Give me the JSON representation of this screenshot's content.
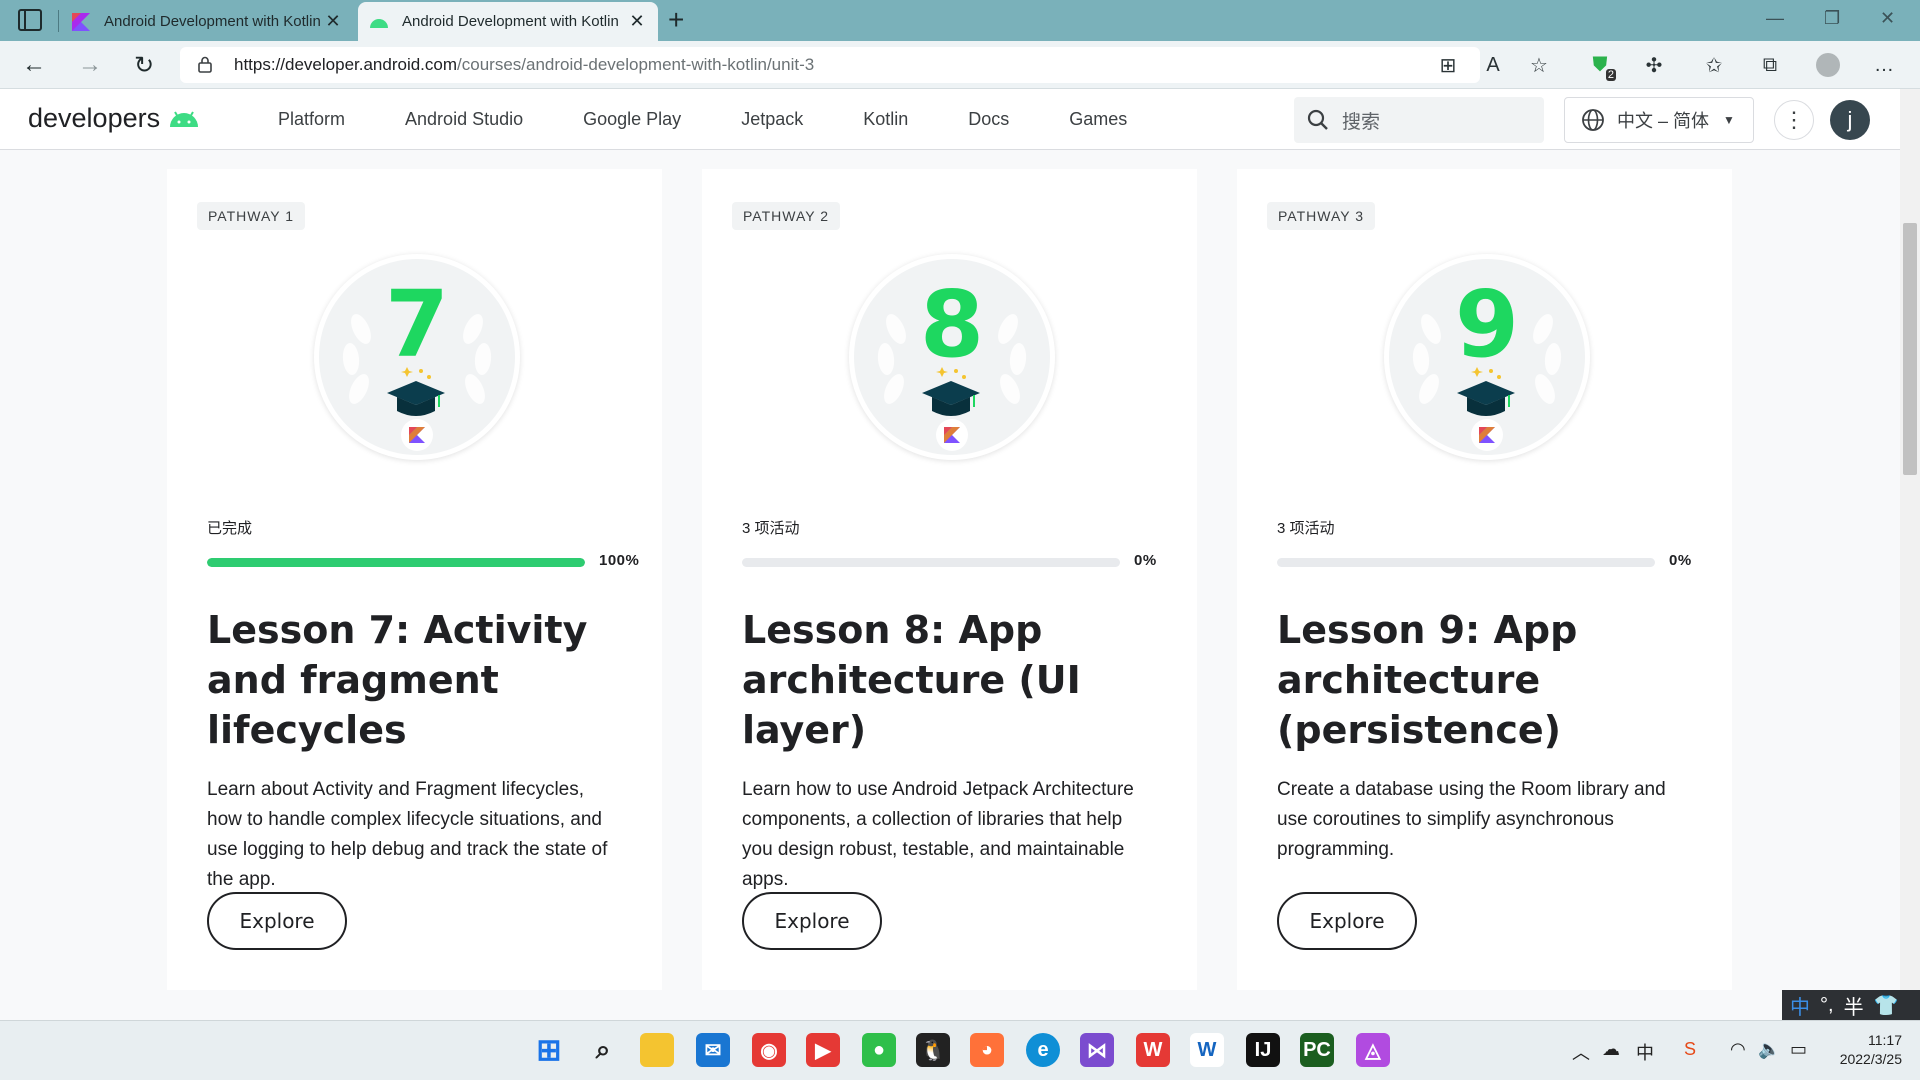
{
  "browser": {
    "tabs": [
      {
        "title": "Android Development with Kotlin"
      },
      {
        "title": "Android Development with Kotlin"
      }
    ],
    "url_host": "https://developer.android.com",
    "url_path": "/courses/android-development-with-kotlin/unit-3",
    "profile_badge": "2"
  },
  "site": {
    "logo_text": "developers",
    "nav": [
      "Platform",
      "Android Studio",
      "Google Play",
      "Jetpack",
      "Kotlin",
      "Docs",
      "Games"
    ],
    "search_placeholder": "搜索",
    "language": "中文 – 简体",
    "avatar_letter": "j"
  },
  "cards": [
    {
      "pathway": "PATHWAY 1",
      "badge_number": "7",
      "status": "已完成",
      "progress": 100,
      "progress_label": "100%",
      "title": "Lesson 7: Activity and fragment lifecycles",
      "description": "Learn about Activity and Fragment lifecycles, how to handle complex lifecycle situations, and use logging to help debug and track the state of the app.",
      "button": "Explore"
    },
    {
      "pathway": "PATHWAY 2",
      "badge_number": "8",
      "status": "3 项活动",
      "progress": 0,
      "progress_label": "0%",
      "title": "Lesson 8: App architecture (UI layer)",
      "description": "Learn how to use Android Jetpack Architecture components, a collection of libraries that help you design robust, testable, and maintainable apps.",
      "button": "Explore"
    },
    {
      "pathway": "PATHWAY 3",
      "badge_number": "9",
      "status": "3 项活动",
      "progress": 0,
      "progress_label": "0%",
      "title": "Lesson 9: App architecture (persistence)",
      "description": "Create a database using the Room library and use coroutines to simplify asynchronous programming.",
      "button": "Explore"
    }
  ],
  "ime": {
    "mode": "中",
    "punct": "°,",
    "width": "半"
  },
  "taskbar": {
    "time": "11:17",
    "date": "2022/3/25"
  },
  "colors": {
    "accent_green": "#1ed760",
    "progress_green": "#2ecc71",
    "tab_bar": "#7ab1ba"
  }
}
